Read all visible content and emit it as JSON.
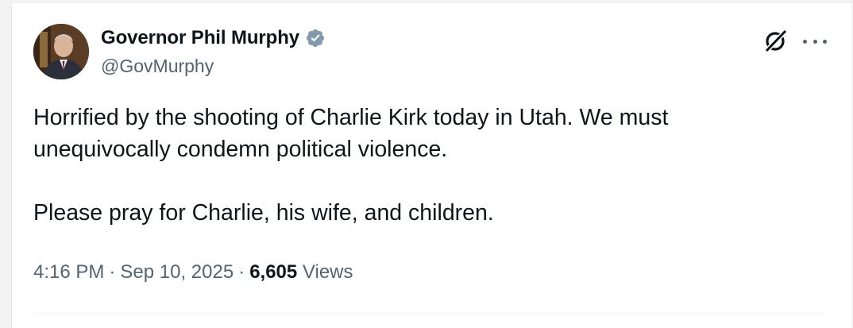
{
  "author": {
    "display_name": "Governor Phil Murphy",
    "handle": "@GovMurphy",
    "verified_icon": "verified-badge-icon"
  },
  "actions": {
    "grok_icon": "grok-icon",
    "more_icon": "more-options-icon"
  },
  "tweet": {
    "paragraphs": [
      "Horrified by the shooting of Charlie Kirk today in Utah. We must unequivocally condemn political violence.",
      "Please pray for Charlie, his wife, and children."
    ],
    "time": "4:16 PM",
    "date": "Sep 10, 2025",
    "separator": "·",
    "views_count": "6,605",
    "views_label": "Views"
  },
  "colors": {
    "text_primary": "#0f1419",
    "text_secondary": "#536471",
    "verified": "#829aab",
    "divider": "#eff3f4"
  }
}
